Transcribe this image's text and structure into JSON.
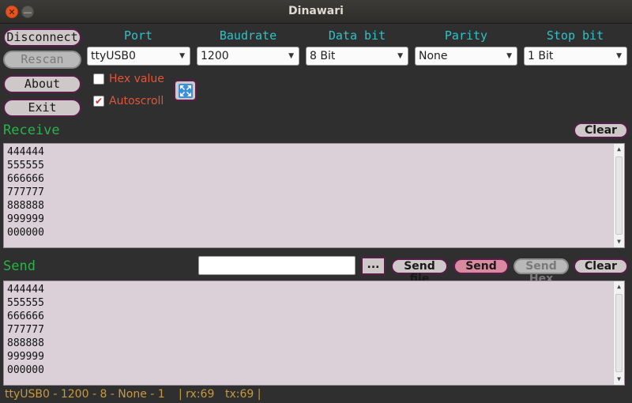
{
  "window": {
    "title": "Dinawari",
    "close_glyph": "✕",
    "min_glyph": "—"
  },
  "left_buttons": {
    "disconnect": "Disconnect",
    "rescan": "Rescan",
    "about": "About",
    "exit": "Exit"
  },
  "columns": {
    "port": {
      "header": "Port",
      "value": "ttyUSB0"
    },
    "baudrate": {
      "header": "Baudrate",
      "value": "1200"
    },
    "databit": {
      "header": "Data bit",
      "value": "8 Bit"
    },
    "parity": {
      "header": "Parity",
      "value": "None"
    },
    "stopbit": {
      "header": "Stop bit",
      "value": "1 Bit"
    }
  },
  "options": {
    "hex_value": {
      "label": "Hex value",
      "checked": false
    },
    "autoscroll": {
      "label": "Autoscroll",
      "checked": true,
      "mark": "✔"
    }
  },
  "receive": {
    "title": "Receive",
    "clear_label": "Clear",
    "lines": [
      "444444",
      "555555",
      "666666",
      "777777",
      "888888",
      "999999",
      "000000"
    ]
  },
  "send": {
    "title": "Send",
    "input_value": "",
    "browse_label": "...",
    "send_file_label": "Send file",
    "send_label": "Send",
    "send_hex_label": "Send Hex",
    "clear_label": "Clear",
    "lines": [
      "444444",
      "555555",
      "666666",
      "777777",
      "888888",
      "999999",
      "000000"
    ]
  },
  "status": {
    "connection": "ttyUSB0 - 1200 - 8 - None - 1",
    "rx": "| rx:69",
    "tx": "tx:69 |"
  },
  "colors": {
    "accent_header": "#2ec2c9",
    "section_title": "#2bb34a",
    "checkbox_label": "#e0563a",
    "status_text": "#c89a3c",
    "textarea_bg": "#dbcfd8",
    "button_border": "#5a1c4a"
  },
  "icons": {
    "fullscreen": "expand-arrows-icon",
    "dropdown": "chevron-down-icon",
    "scroll_up": "scroll-up-arrow-icon",
    "scroll_down": "scroll-down-arrow-icon"
  }
}
